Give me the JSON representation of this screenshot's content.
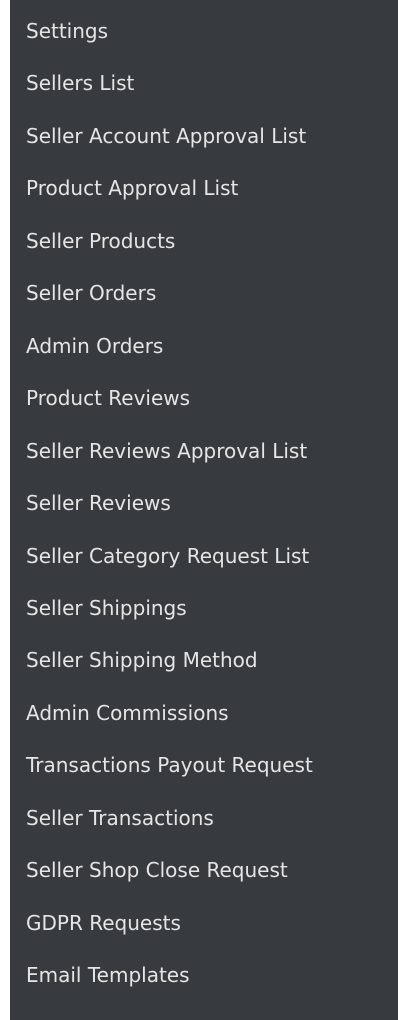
{
  "sidebar": {
    "items": [
      {
        "label": "Settings"
      },
      {
        "label": "Sellers List"
      },
      {
        "label": "Seller Account Approval List"
      },
      {
        "label": "Product Approval List"
      },
      {
        "label": "Seller Products"
      },
      {
        "label": "Seller Orders"
      },
      {
        "label": "Admin Orders"
      },
      {
        "label": "Product Reviews"
      },
      {
        "label": "Seller Reviews Approval List"
      },
      {
        "label": "Seller Reviews"
      },
      {
        "label": "Seller Category Request List"
      },
      {
        "label": "Seller Shippings"
      },
      {
        "label": "Seller Shipping Method"
      },
      {
        "label": "Admin Commissions"
      },
      {
        "label": "Transactions Payout Request"
      },
      {
        "label": "Seller Transactions"
      },
      {
        "label": "Seller Shop Close Request"
      },
      {
        "label": "GDPR Requests"
      },
      {
        "label": "Email Templates"
      }
    ]
  },
  "colors": {
    "menu_background": "#373a3f",
    "menu_text": "#e5e5e5"
  }
}
